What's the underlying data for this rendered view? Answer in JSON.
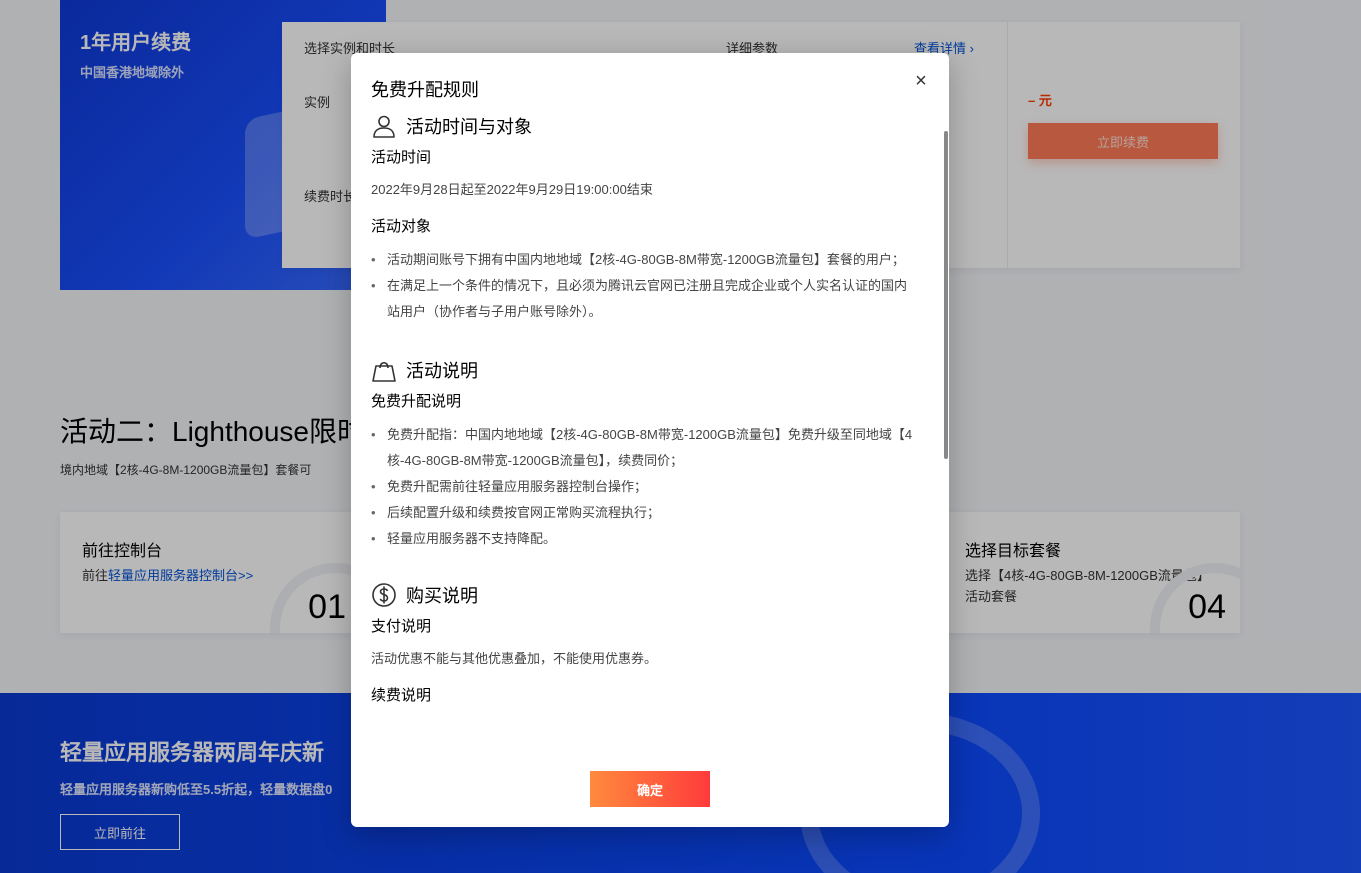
{
  "background": {
    "promo_card": {
      "title": "1年用户续费",
      "subtitle": "中国香港地域除外"
    },
    "renew_panel": {
      "select_label": "选择实例和时长",
      "params_label": "详细参数",
      "detail_link": "查看详情 ›",
      "instance_label": "实例",
      "renew_label": "续费时长",
      "price": "– 元",
      "buy_button": "立即续费"
    },
    "activity2": {
      "title": "活动二：Lighthouse限时",
      "subtitle": "境内地域【2核-4G-8M-1200GB流量包】套餐可"
    },
    "steps": [
      {
        "title": "前往控制台",
        "desc_prefix": "前往",
        "desc_link": "轻量应用服务器控制台>>",
        "num": "01"
      },
      {
        "title": "选择目标套餐",
        "desc": "选择【4核-4G-80GB-8M-1200GB流量包】活动套餐",
        "num": "04"
      }
    ],
    "bottom_banner": {
      "title": "轻量应用服务器两周年庆新",
      "subtitle": "轻量应用服务器新购低至5.5折起，轻量数据盘0",
      "button": "立即前往"
    }
  },
  "modal": {
    "title": "免费升配规则",
    "close_icon": "×",
    "ok_button": "确定",
    "sections": {
      "time_target": {
        "heading": "活动时间与对象",
        "icon": "user-icon",
        "time_title": "活动时间",
        "time_text": "2022年9月28日起至2022年9月29日19:00:00结束",
        "target_title": "活动对象",
        "target_items": [
          "活动期间账号下拥有中国内地地域【2核-4G-80GB-8M带宽-1200GB流量包】套餐的用户；",
          "在满足上一个条件的情况下，且必须为腾讯云官网已注册且完成企业或个人实名认证的国内站用户（协作者与子用户账号除外）。"
        ]
      },
      "description": {
        "heading": "活动说明",
        "icon": "shopping-bag-icon",
        "sub_title": "免费升配说明",
        "items": [
          "免费升配指：中国内地地域【2核-4G-80GB-8M带宽-1200GB流量包】免费升级至同地域【4核-4G-80GB-8M带宽-1200GB流量包】，续费同价；",
          "免费升配需前往轻量应用服务器控制台操作；",
          "后续配置升级和续费按官网正常购买流程执行；",
          "轻量应用服务器不支持降配。"
        ]
      },
      "purchase": {
        "heading": "购买说明",
        "icon": "dollar-coin-icon",
        "pay_title": "支付说明",
        "pay_text": "活动优惠不能与其他优惠叠加，不能使用优惠券。",
        "renew_title": "续费说明"
      }
    }
  },
  "colors": {
    "brand_blue": "#0052d9",
    "ok_gradient_start": "#ff8a3d",
    "ok_gradient_end": "#ff3b3b"
  }
}
